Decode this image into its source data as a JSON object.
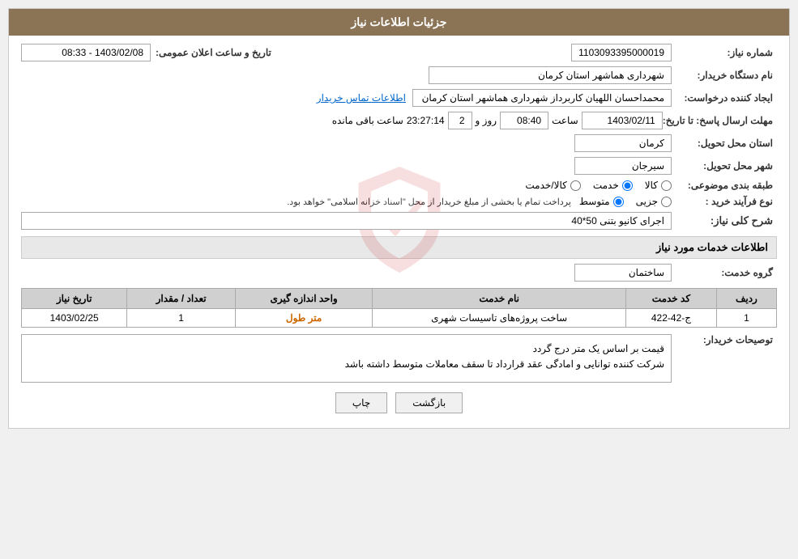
{
  "page": {
    "title": "جزئیات اطلاعات نیاز"
  },
  "fields": {
    "shomara_niaz_label": "شماره نیاز:",
    "shomara_niaz_value": "1103093395000019",
    "nam_dastgah_label": "نام دستگاه خریدار:",
    "nam_dastgah_value": "شهرداری هماشهر استان کرمان",
    "ijad_konande_label": "ایجاد کننده درخواست:",
    "ijad_konande_value": "محمداحسان اللهیان کاربرداز  شهرداری هماشهر استان کرمان",
    "ijad_konande_link": "اطلاعات تماس خریدار",
    "mohlat_label": "مهلت ارسال پاسخ: تا تاریخ:",
    "mohlat_date": "1403/02/11",
    "mohlat_saat_label": "ساعت",
    "mohlat_saat": "08:40",
    "mohlat_rooz_label": "روز و",
    "mohlat_rooz": "2",
    "mohlat_mande": "23:27:14",
    "mohlat_mande_label": "ساعت باقی مانده",
    "ostan_label": "استان محل تحویل:",
    "ostan_value": "کرمان",
    "shahr_label": "شهر محل تحویل:",
    "shahr_value": "سیرجان",
    "tabaqe_label": "طبقه بندی موضوعی:",
    "tabaqe_kala": "کالا",
    "tabaqe_khedmat": "خدمت",
    "tabaqe_kala_khedmat": "کالا/خدمت",
    "tabaqe_selected": "khedmat",
    "nooe_farayand_label": "نوع فرآیند خرید :",
    "nooe_jozi": "جزیی",
    "nooe_mootasat": "متوسط",
    "nooe_note": "پرداخت تمام یا بخشی از مبلغ خریدار از محل \"اسناد خزانه اسلامی\" خواهد بود.",
    "sharh_section": "شرح کلی نیاز:",
    "sharh_value": "اجرای کانیو بتنی 50*40",
    "service_section": "اطلاعات خدمات مورد نیاز",
    "group_label": "گروه خدمت:",
    "group_value": "ساختمان",
    "table_headers": {
      "radif": "ردیف",
      "kod_khedmat": "کد خدمت",
      "nam_khedmat": "نام خدمت",
      "vahed": "واحد اندازه گیری",
      "tedad": "تعداد / مقدار",
      "tarikh": "تاریخ نیاز"
    },
    "table_rows": [
      {
        "radif": "1",
        "kod": "ج-42-422",
        "nam": "ساخت پروژه‌های تاسیسات شهری",
        "vahed": "متر طول",
        "tedad": "1",
        "tarikh": "1403/02/25"
      }
    ],
    "tawsif_label": "توصیحات خریدار:",
    "tawsif_line1": "قیمت بر اساس یک متر درج گردد",
    "tawsif_line2": "شرکت کننده توانایی و امادگی عقد قرارداد تا سقف معاملات متوسط داشته باشد",
    "btn_chap": "چاپ",
    "btn_bazgasht": "بازگشت",
    "tarikh_label": "تاریخ و ساعت اعلان عمومی:",
    "tarikh_value": "1403/02/08 - 08:33"
  }
}
